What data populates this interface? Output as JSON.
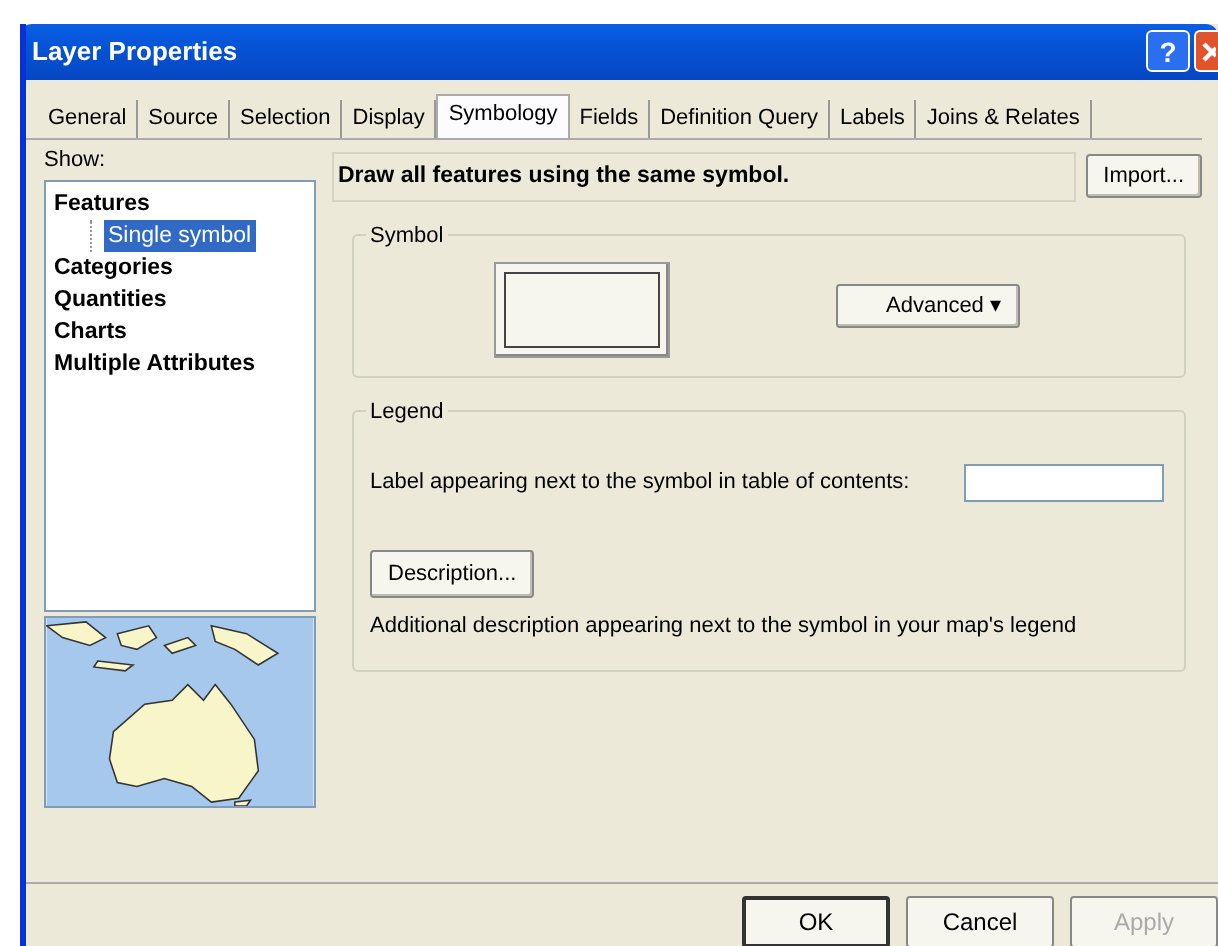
{
  "window": {
    "title": "Layer Properties",
    "title_buttons": [
      "?"
    ]
  },
  "tabs": [
    {
      "label": "General",
      "selected": false
    },
    {
      "label": "Source",
      "selected": false
    },
    {
      "label": "Selection",
      "selected": false
    },
    {
      "label": "Display",
      "selected": false
    },
    {
      "label": "Symbology",
      "selected": true
    },
    {
      "label": "Fields",
      "selected": false
    },
    {
      "label": "Definition Query",
      "selected": false
    },
    {
      "label": "Labels",
      "selected": false
    },
    {
      "label": "Joins & Relates",
      "selected": false
    }
  ],
  "show": {
    "label": "Show:",
    "tree": [
      {
        "label": "Features",
        "selected": false,
        "children": [
          {
            "label": "Single symbol",
            "selected": true
          }
        ]
      },
      {
        "label": "Categories",
        "selected": false
      },
      {
        "label": "Quantities",
        "selected": false
      },
      {
        "label": "Charts",
        "selected": false
      },
      {
        "label": "Multiple Attributes",
        "selected": false
      }
    ]
  },
  "header": {
    "text": "Draw all features using the same symbol.",
    "button": "Import..."
  },
  "symbol_group": {
    "title": "Symbol",
    "advanced_button": {
      "label": "Advanced",
      "caret": "▾"
    }
  },
  "legend_group": {
    "title": "Legend",
    "label_prompt": "Label appearing next to the symbol in table of contents:",
    "description_button": "Description...",
    "description_note": "Additional description appearing next to the symbol in your map's legend"
  },
  "buttons": [
    {
      "label": "OK",
      "default": true,
      "disabled": false
    },
    {
      "label": "Cancel",
      "default": false,
      "disabled": false
    },
    {
      "label": "Apply",
      "default": false,
      "disabled": true
    }
  ]
}
